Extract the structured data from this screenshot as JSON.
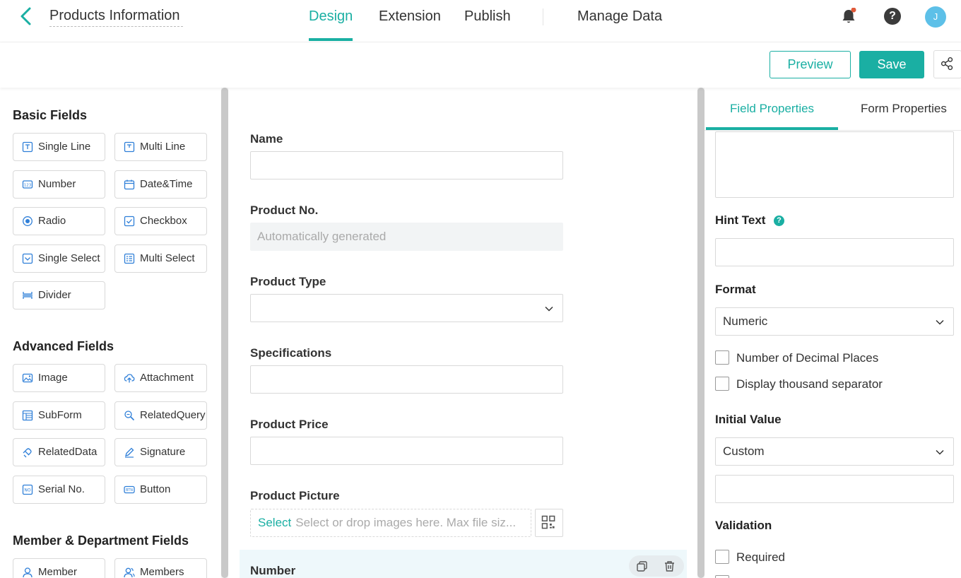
{
  "header": {
    "title": "Products Information",
    "tabs": [
      {
        "label": "Design",
        "active": true
      },
      {
        "label": "Extension",
        "active": false
      },
      {
        "label": "Publish",
        "active": false
      },
      {
        "label": "Manage Data",
        "active": false
      }
    ],
    "avatar_initial": "J",
    "help_glyph": "?"
  },
  "actions": {
    "preview_label": "Preview",
    "save_label": "Save"
  },
  "colors": {
    "accent": "#1aafa3",
    "avatar": "#5dc0e8",
    "notification_dot": "#e05a3a"
  },
  "left_panel": {
    "basic_title": "Basic Fields",
    "basic": [
      {
        "label": "Single Line",
        "icon": "single-line-icon"
      },
      {
        "label": "Multi Line",
        "icon": "multi-line-icon"
      },
      {
        "label": "Number",
        "icon": "number-icon"
      },
      {
        "label": "Date&Time",
        "icon": "calendar-icon"
      },
      {
        "label": "Radio",
        "icon": "radio-icon"
      },
      {
        "label": "Checkbox",
        "icon": "checkbox-icon"
      },
      {
        "label": "Single Select",
        "icon": "single-select-icon"
      },
      {
        "label": "Multi Select",
        "icon": "multi-select-icon"
      },
      {
        "label": "Divider",
        "icon": "divider-icon"
      }
    ],
    "advanced_title": "Advanced Fields",
    "advanced": [
      {
        "label": "Image",
        "icon": "image-icon"
      },
      {
        "label": "Attachment",
        "icon": "upload-cloud-icon"
      },
      {
        "label": "SubForm",
        "icon": "subform-icon"
      },
      {
        "label": "RelatedQuery",
        "icon": "related-query-icon"
      },
      {
        "label": "RelatedData",
        "icon": "related-data-icon"
      },
      {
        "label": "Signature",
        "icon": "pen-icon"
      },
      {
        "label": "Serial No.",
        "icon": "serial-no-icon"
      },
      {
        "label": "Button",
        "icon": "button-icon"
      }
    ],
    "member_title": "Member & Department Fields",
    "member": [
      {
        "label": "Member",
        "icon": "user-icon"
      },
      {
        "label": "Members",
        "icon": "users-icon"
      }
    ]
  },
  "form": {
    "fields": {
      "name": {
        "label": "Name"
      },
      "product_no": {
        "label": "Product No.",
        "value": "Automatically generated"
      },
      "product_type": {
        "label": "Product Type"
      },
      "specifications": {
        "label": "Specifications"
      },
      "product_price": {
        "label": "Product Price"
      },
      "product_picture": {
        "label": "Product Picture",
        "select_label": "Select",
        "placeholder": "Select or drop images here. Max file siz..."
      },
      "number": {
        "label": "Number"
      }
    }
  },
  "right_panel": {
    "tabs": [
      {
        "label": "Field Properties",
        "active": true
      },
      {
        "label": "Form Properties",
        "active": false
      }
    ],
    "hint_text_label": "Hint Text",
    "hint_icon_glyph": "?",
    "format_label": "Format",
    "format_value": "Numeric",
    "options": [
      {
        "label": "Number of Decimal Places",
        "checked": false
      },
      {
        "label": "Display thousand separator",
        "checked": false
      }
    ],
    "initial_value_label": "Initial Value",
    "initial_value_mode": "Custom",
    "validation_label": "Validation",
    "validation_options": [
      {
        "label": "Required",
        "checked": false
      }
    ]
  }
}
